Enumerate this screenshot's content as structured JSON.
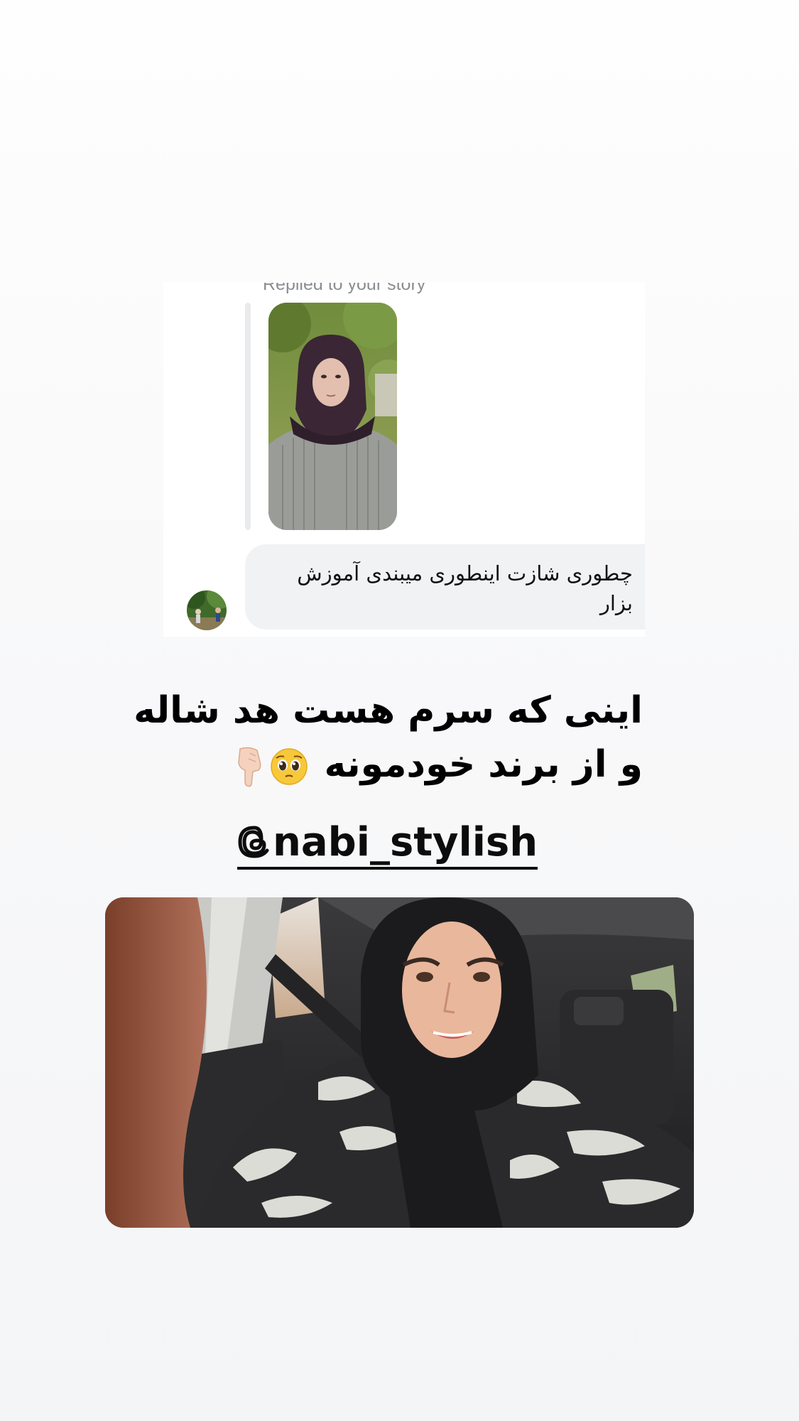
{
  "story_reply": {
    "replied_label": "Replied to your story",
    "message": "چطوری شازت اینطوری میبندی آموزش بزار"
  },
  "caption": {
    "line1": "اینی که سرم هست هد شاله",
    "line2_text": "و از برند خودمونه",
    "line2_emojis": [
      "pleading-face",
      "backhand-index-pointing-down"
    ]
  },
  "mention": {
    "handle": "nabi_stylish",
    "icon": "threads-icon"
  },
  "colors": {
    "bubble": "#f1f2f4",
    "text": "#000000",
    "muted_label": "#8a8d92"
  }
}
